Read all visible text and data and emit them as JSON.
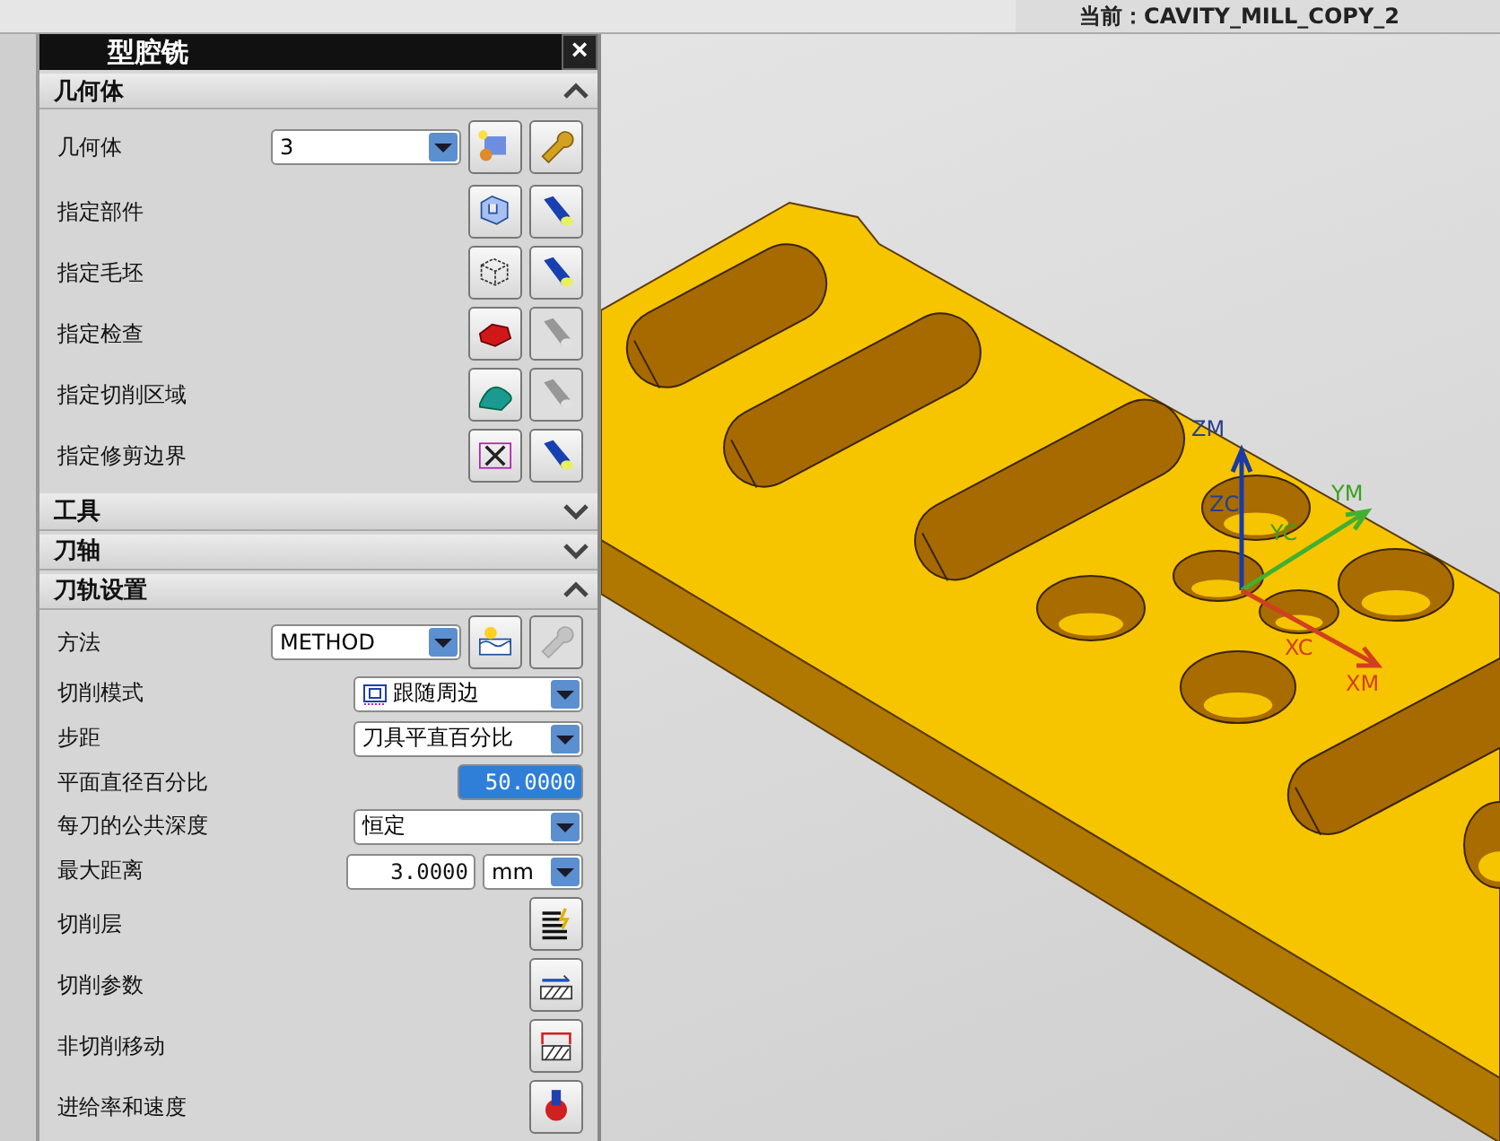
{
  "top_bar": {
    "current": "当前：CAVITY_MILL_COPY_2"
  },
  "dialog": {
    "title": "型腔铣",
    "close": "×",
    "sections": [
      {
        "title": "几何体",
        "expanded": true,
        "rows": [
          {
            "kind": "select_buttons",
            "label": "几何体",
            "value": "3",
            "buttons": [
              {
                "disabled": false
              },
              {
                "disabled": false
              }
            ]
          },
          {
            "kind": "buttons",
            "label": "指定部件",
            "buttons": [
              {
                "disabled": false
              },
              {
                "disabled": false
              }
            ]
          },
          {
            "kind": "buttons",
            "label": "指定毛坯",
            "buttons": [
              {
                "disabled": false
              },
              {
                "disabled": false
              }
            ]
          },
          {
            "kind": "buttons",
            "label": "指定检查",
            "buttons": [
              {
                "disabled": false
              },
              {
                "disabled": true
              }
            ]
          },
          {
            "kind": "buttons",
            "label": "指定切削区域",
            "buttons": [
              {
                "disabled": false
              },
              {
                "disabled": true
              }
            ]
          },
          {
            "kind": "buttons",
            "label": "指定修剪边界",
            "buttons": [
              {
                "disabled": false
              },
              {
                "disabled": false
              }
            ]
          }
        ]
      },
      {
        "title": "工具",
        "expanded": false
      },
      {
        "title": "刀轴",
        "expanded": false
      },
      {
        "title": "刀轨设置",
        "expanded": true,
        "rows": [
          {
            "kind": "select_buttons",
            "label": "方法",
            "value": "METHOD",
            "buttons": [
              {
                "disabled": false
              },
              {
                "disabled": true
              }
            ]
          },
          {
            "kind": "select",
            "label": "切削模式",
            "value": "跟随周边"
          },
          {
            "kind": "select",
            "label": "步距",
            "value": "刀具平直百分比"
          },
          {
            "kind": "input",
            "label": "平面直径百分比",
            "value": "50.0000",
            "selected": true
          },
          {
            "kind": "select",
            "label": "每刀的公共深度",
            "value": "恒定"
          },
          {
            "kind": "input_unit",
            "label": "最大距离",
            "value": "3.0000",
            "selected": false,
            "unit": "mm"
          },
          {
            "kind": "button",
            "label": "切削层"
          },
          {
            "kind": "button",
            "label": "切削参数"
          },
          {
            "kind": "button",
            "label": "非切削移动"
          },
          {
            "kind": "button",
            "label": "进给率和速度"
          }
        ]
      }
    ]
  },
  "viewport": {
    "axis_labels": [
      "ZM",
      "ZC",
      "YC",
      "YM",
      "XC",
      "XM"
    ]
  }
}
